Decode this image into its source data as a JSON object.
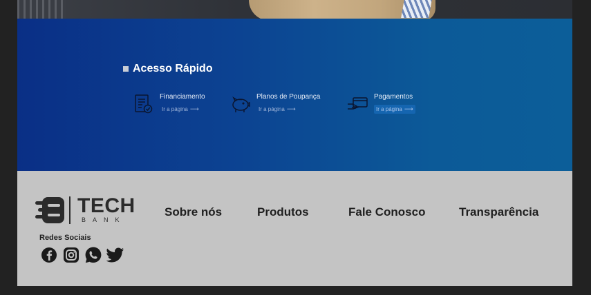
{
  "quick_access": {
    "title": "Acesso Rápido",
    "items": [
      {
        "label": "Financiamento",
        "link": "Ir a página",
        "icon": "document-check-icon"
      },
      {
        "label": "Planos de Poupança",
        "link": "Ir a página",
        "icon": "piggy-bank-icon"
      },
      {
        "label": "Pagamentos",
        "link": "Ir a página",
        "icon": "card-payment-icon"
      }
    ],
    "link_arrow": "⟶"
  },
  "footer": {
    "logo": {
      "word": "TECH",
      "sub": "BANK"
    },
    "nav": [
      "Sobre nós",
      "Produtos",
      "Fale Conosco",
      "Transparência"
    ],
    "social_title": "Redes Sociais",
    "social": [
      "facebook-icon",
      "instagram-icon",
      "whatsapp-icon",
      "twitter-icon"
    ]
  },
  "colors": {
    "panel_start": "#0a2f86",
    "panel_end": "#0c5e99",
    "footer_bg": "#c4c4c4",
    "text_dark": "#1f1f1f"
  }
}
